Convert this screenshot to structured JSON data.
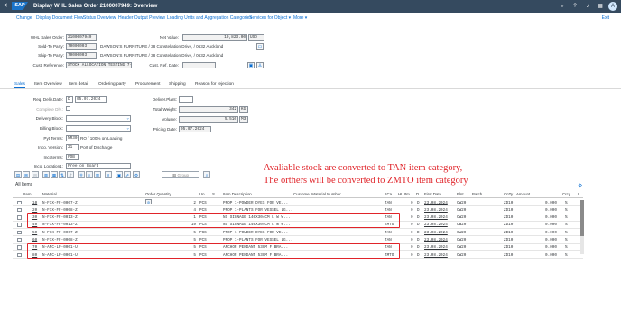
{
  "shell": {
    "back": "<",
    "logo": "SAP",
    "title": "Display WHL Sales Order 2100007949: Overview",
    "icons": [
      "search-icon",
      "help-icon",
      "bell-icon",
      "grid-icon"
    ],
    "avatar": "A"
  },
  "toolbar": {
    "items": [
      "Change",
      "Display Document Flow",
      "Status Overview",
      "Header Output Preview",
      "Loading Units and Aggregation Categories",
      "Services for Object ▾",
      "More ▾"
    ],
    "exit": "Exit"
  },
  "header": {
    "sales_order_label": "WHL Sales Order:",
    "sales_order_value": "2100007949",
    "net_value_label": "Net Value:",
    "net_value": "19,823.00",
    "currency": "USD",
    "sold_to_label": "Sold-To Party:",
    "sold_to_value": "70000003",
    "sold_to_name": "DAWSON'S FURNITURE / 38 Constellation Drive, / 0632 Auckland",
    "ship_to_label": "Ship-To Party:",
    "ship_to_value": "70000003",
    "ship_to_name": "DAWSON'S FURNITURE / 38 Constellation Drive, / 0632 Auckland",
    "cust_ref_label": "Cust. Reference:",
    "cust_ref_value": "STOCK ALLOCATION TESTING 7-2",
    "cust_ref_date_label": "Cust. Ref. Date:"
  },
  "tabs": [
    "Sales",
    "Item Overview",
    "Item detail",
    "Ordering party",
    "Procurement",
    "Shipping",
    "Reason for rejection"
  ],
  "sales": {
    "req_deliv_date_label": "Req. Deliv.Date:",
    "req_deliv_date_d": "D",
    "req_deliv_date": "05.07.2024",
    "complete_dlv_label": "Complete Dlv.:",
    "delivery_block_label": "Delivery Block:",
    "billing_block_label": "Billing Block:",
    "pyt_terms_label": "Pyt Terms:",
    "pyt_terms_value": "NR30",
    "pyt_terms_text": "RO / 100% on Loading",
    "incoterms_version_label": "Inco. Version:",
    "incoterms_version_value": "21",
    "incoterms_version_text": "Port of Discharge",
    "incoterms_label": "Incoterms:",
    "incoterms_value": "FOB",
    "inco_location_label": "Inco. Location1:",
    "inco_location_value": "Free on Board",
    "deliver_plant_label": "Deliver.Plant:",
    "total_weight_label": "Total Weight:",
    "total_weight_value": "342",
    "total_weight_unit": "KG",
    "volume_label": "Volume:",
    "volume_value": "5.510",
    "volume_unit": "M3",
    "pricing_date_label": "Pricing Date:",
    "pricing_date_value": "05.07.2024"
  },
  "grid": {
    "title": "All Items",
    "group_label": "Group",
    "columns": [
      "Item",
      "Material",
      "Order Quantity",
      "Un",
      "S",
      "Item Description",
      "Customer Material Number",
      "ItCa",
      "HL Itm",
      "D..",
      "First Date",
      "Plnt",
      "Batch",
      "CnTy",
      "Amount",
      "Crcy",
      "I"
    ],
    "rows": [
      {
        "item": "10",
        "material": "N-FIX-FF-0007-Z",
        "qty": "2",
        "un": "PCS",
        "desc": "PROP 1-POWDER DYES FOR VE...",
        "itca": "TAN",
        "hl": "0",
        "d": "D",
        "date": "23.08.2024",
        "plnt": "CW20",
        "cnty": "ZD10",
        "amount": "0.000",
        "crcy": "%"
      },
      {
        "item": "20",
        "material": "N-FIX-FF-0008-Z",
        "qty": "4",
        "un": "PCS",
        "desc": "PROP 1-PLANTS FOR VESSEL LG...",
        "itca": "TAN",
        "hl": "0",
        "d": "D",
        "date": "23.08.2024",
        "plnt": "CW20",
        "cnty": "ZD10",
        "amount": "0.000",
        "crcy": "%"
      },
      {
        "item": "30",
        "material": "N-FIX-FF-0013-Z",
        "qty": "1",
        "un": "PCS",
        "desc": "NS SIGNAGE 140X304CM L W W...",
        "itca": "TAN",
        "hl": "0",
        "d": "D",
        "date": "23.08.2024",
        "plnt": "CW20",
        "cnty": "ZD10",
        "amount": "0.000",
        "crcy": "%"
      },
      {
        "item": "40",
        "material": "N-FIX-FF-0013-Z",
        "qty": "19",
        "un": "PCS",
        "desc": "NS SIGNAGE 140X304CM L W W...",
        "itca": "ZMTO",
        "hl": "0",
        "d": "D",
        "date": "23.08.2024",
        "plnt": "CW20",
        "cnty": "ZD10",
        "amount": "0.000",
        "crcy": "%"
      },
      {
        "item": "50",
        "material": "N-FIX-FF-0007-Z",
        "qty": "5",
        "un": "PCS",
        "desc": "PROP 1-POWDER DYES FOR VE...",
        "itca": "TAN",
        "hl": "0",
        "d": "D",
        "date": "23.08.2024",
        "plnt": "CW20",
        "cnty": "ZD10",
        "amount": "0.000",
        "crcy": "%"
      },
      {
        "item": "60",
        "material": "N-FIX-FF-0008-Z",
        "qty": "5",
        "un": "PCS",
        "desc": "PROP 1-PLANTS FOR VESSEL LG...",
        "itca": "TAN",
        "hl": "0",
        "d": "D",
        "date": "23.08.2024",
        "plnt": "CW20",
        "cnty": "ZD10",
        "amount": "0.000",
        "crcy": "%"
      },
      {
        "item": "70",
        "material": "N-ANC-LP-0001-U",
        "qty": "5",
        "un": "PCS",
        "desc": "ANCHOR PENDANT 53CM F.BRA...",
        "itca": "TAN",
        "hl": "0",
        "d": "D",
        "date": "23.08.2024",
        "plnt": "CW20",
        "cnty": "ZD10",
        "amount": "0.000",
        "crcy": "%"
      },
      {
        "item": "80",
        "material": "N-ANC-LP-0001-U",
        "qty": "5",
        "un": "PCS",
        "desc": "ANCHOR PENDANT 53CM F.BRA...",
        "itca": "ZMTO",
        "hl": "0",
        "d": "D",
        "date": "23.08.2024",
        "plnt": "CW20",
        "cnty": "ZD10",
        "amount": "0.000",
        "crcy": "%"
      }
    ]
  },
  "annotation": {
    "line1": "Avaliable stock are converted to TAN item category,",
    "line2": "The orthers will be converted to ZMTO item category"
  },
  "colors": {
    "shell": "#354a5f",
    "link": "#0a6ed1",
    "highlight": "#e0242a"
  }
}
